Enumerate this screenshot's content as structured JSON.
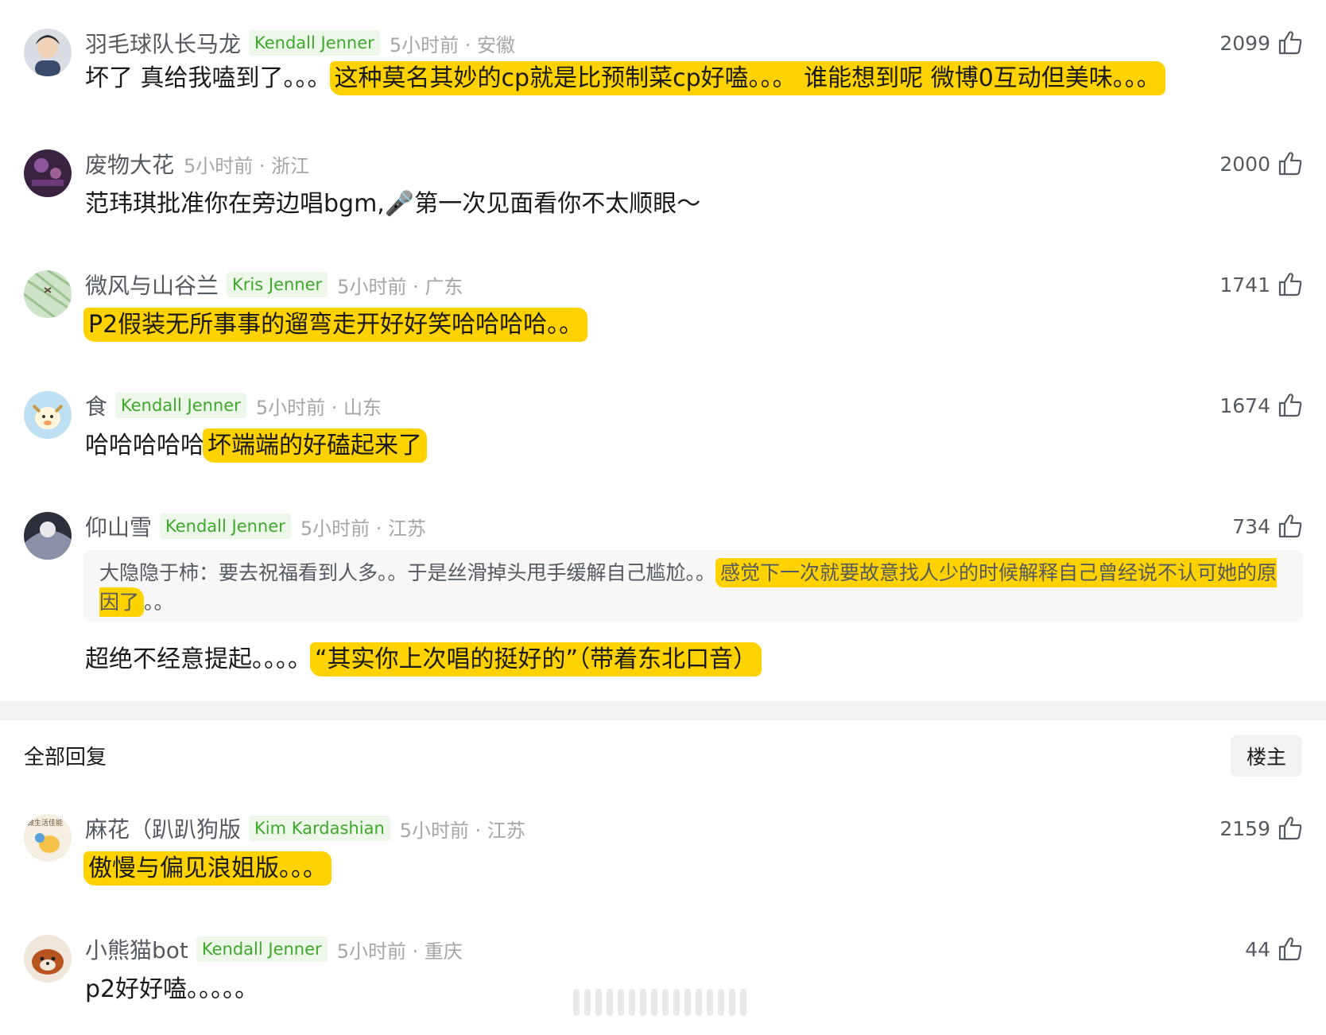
{
  "comments": [
    {
      "username": "羽毛球队长马龙",
      "badge": "Kendall Jenner",
      "time_location": "5小时前 · 安徽",
      "likes": "2099",
      "text_plain": "坏了 真给我嗑到了。。。",
      "text_highlight": "这种莫名其妙的cp就是比预制菜cp好嗑。。。 谁能想到呢 微博0互动但美味。。。"
    },
    {
      "username": "废物大花",
      "time_location": "5小时前 · 浙江",
      "likes": "2000",
      "text_plain": "范玮琪批准你在旁边唱bgm,🎤第一次见面看你不太顺眼～"
    },
    {
      "username": "微风与山谷兰",
      "badge": "Kris Jenner",
      "time_location": "5小时前 · 广东",
      "likes": "1741",
      "text_highlight": "P2假装无所事事的遛弯走开好好笑哈哈哈哈。。"
    },
    {
      "username": "食",
      "badge": "Kendall Jenner",
      "time_location": "5小时前 · 山东",
      "likes": "1674",
      "text_plain": "哈哈哈哈哈",
      "text_highlight": "坏端端的好磕起来了"
    },
    {
      "username": "仰山雪",
      "badge": "Kendall Jenner",
      "time_location": "5小时前 · 江苏",
      "likes": "734",
      "quote_plain": "大隐隐于柿：要去祝福看到人多。。于是丝滑掉头甩手缓解自己尴尬。。",
      "quote_highlight": "感觉下一次就要故意找人少的时候解释自己曾经说不认可她的原因了",
      "quote_tail": "。。",
      "text_plain": "超绝不经意提起。。。。",
      "text_highlight": "“其实你上次唱的挺好的”（带着东北口音）"
    }
  ],
  "section": {
    "title": "全部回复",
    "op_button": "楼主"
  },
  "replies": [
    {
      "username": "麻花（趴趴狗版",
      "badge": "Kim Kardashian",
      "time_location": "5小时前 · 江苏",
      "likes": "2159",
      "text_highlight": "傲慢与偏见浪姐版。。。",
      "avatar_text": "做生活佳能"
    },
    {
      "username": "小熊猫bot",
      "badge": "Kendall Jenner",
      "time_location": "5小时前 · 重庆",
      "likes": "44",
      "text_plain": "p2好好嗑。。。。。"
    }
  ],
  "colors": {
    "highlight": "#ffd200",
    "badge_text": "#3da82a",
    "badge_bg": "#eef8ea",
    "meta_gray": "#a6a6a6",
    "divider": "#f2f2f2"
  },
  "icons": {
    "like": "thumbs-up-icon"
  }
}
